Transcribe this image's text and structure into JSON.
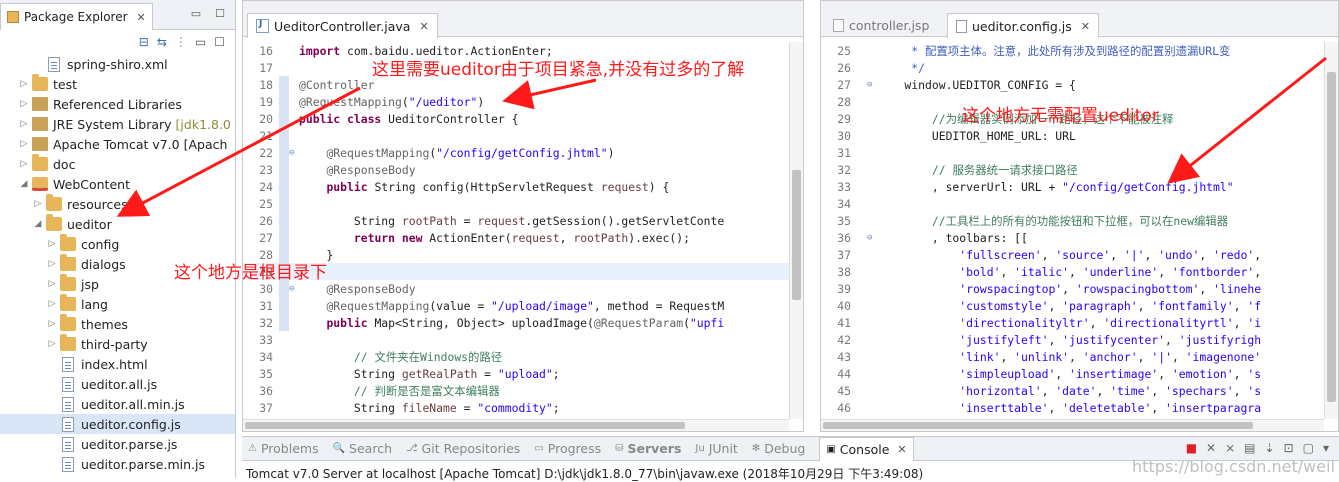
{
  "package_explorer": {
    "title": "Package Explorer",
    "tree": [
      {
        "label": "spring-shiro.xml",
        "indent": 2,
        "icon": "xml-file-icon",
        "twisty": ""
      },
      {
        "label": "test",
        "indent": 1,
        "icon": "folder-icon",
        "twisty": "closed"
      },
      {
        "label": "Referenced Libraries",
        "indent": 1,
        "icon": "library-icon",
        "twisty": "closed"
      },
      {
        "label": "JRE System Library",
        "suffix": "[jdk1.8.0",
        "indent": 1,
        "icon": "library-icon",
        "twisty": "closed"
      },
      {
        "label": "Apache Tomcat v7.0 [Apach",
        "indent": 1,
        "icon": "library-icon",
        "twisty": "closed"
      },
      {
        "label": "doc",
        "indent": 1,
        "icon": "folder-icon",
        "twisty": "closed"
      },
      {
        "label": "WebContent",
        "indent": 1,
        "icon": "webcontent-folder-icon",
        "twisty": "open"
      },
      {
        "label": "resources",
        "indent": 2,
        "icon": "folder-icon",
        "twisty": "closed"
      },
      {
        "label": "ueditor",
        "indent": 2,
        "icon": "folder-icon",
        "twisty": "open"
      },
      {
        "label": "config",
        "indent": 3,
        "icon": "folder-icon",
        "twisty": "closed"
      },
      {
        "label": "dialogs",
        "indent": 3,
        "icon": "folder-icon",
        "twisty": "closed"
      },
      {
        "label": "jsp",
        "indent": 3,
        "icon": "folder-icon",
        "twisty": "closed"
      },
      {
        "label": "lang",
        "indent": 3,
        "icon": "folder-icon",
        "twisty": "closed"
      },
      {
        "label": "themes",
        "indent": 3,
        "icon": "folder-icon",
        "twisty": "closed"
      },
      {
        "label": "third-party",
        "indent": 3,
        "icon": "folder-icon",
        "twisty": "closed"
      },
      {
        "label": "index.html",
        "indent": 3,
        "icon": "file-icon",
        "twisty": ""
      },
      {
        "label": "ueditor.all.js",
        "indent": 3,
        "icon": "file-icon",
        "twisty": ""
      },
      {
        "label": "ueditor.all.min.js",
        "indent": 3,
        "icon": "file-icon",
        "twisty": ""
      },
      {
        "label": "ueditor.config.js",
        "indent": 3,
        "icon": "file-icon",
        "twisty": "",
        "selected": true
      },
      {
        "label": "ueditor.parse.js",
        "indent": 3,
        "icon": "file-icon",
        "twisty": ""
      },
      {
        "label": "ueditor.parse.min.js",
        "indent": 3,
        "icon": "file-icon",
        "twisty": ""
      }
    ]
  },
  "editor_left": {
    "tab": "UeditorController.java",
    "lines": [
      {
        "n": "16",
        "html": "<span class='kw'>import</span> com.baidu.ueditor.ActionEnter;"
      },
      {
        "n": "17",
        "html": ""
      },
      {
        "n": "18",
        "html": "<span class='ann'>@Controller</span>",
        "marker": true
      },
      {
        "n": "19",
        "html": "<span class='ann'>@RequestMapping</span>(<span class='str'>\"/ueditor\"</span>)",
        "marker": true
      },
      {
        "n": "20",
        "html": "<span class='kw'>public class</span> UeditorController {",
        "marker": true
      },
      {
        "n": "21",
        "html": "",
        "marker": true
      },
      {
        "n": "22",
        "html": "    <span class='ann'>@RequestMapping</span>(<span class='str'>\"/config/getConfig.jhtml\"</span>)",
        "marker": true,
        "fold": true
      },
      {
        "n": "23",
        "html": "    <span class='ann'>@ResponseBody</span>",
        "marker": true
      },
      {
        "n": "24",
        "html": "    <span class='kw'>public</span> String config(HttpServletRequest <span style='color:#6a3e3e'>request</span>) {",
        "marker": true
      },
      {
        "n": "25",
        "html": "",
        "marker": true
      },
      {
        "n": "26",
        "html": "        String <span style='color:#6a3e3e'>rootPath</span> = <span style='color:#6a3e3e'>request</span>.getSession().getServletConte",
        "marker": true
      },
      {
        "n": "27",
        "html": "        <span class='kw'>return new</span> ActionEnter(<span style='color:#6a3e3e'>request</span>, <span style='color:#6a3e3e'>rootPath</span>).exec();",
        "marker": true
      },
      {
        "n": "28",
        "html": "    }",
        "marker": true
      },
      {
        "n": "29",
        "html": "",
        "marker": true,
        "hl": true
      },
      {
        "n": "30",
        "html": "    <span class='ann'>@ResponseBody</span>",
        "marker": true,
        "fold": true
      },
      {
        "n": "31",
        "html": "    <span class='ann'>@RequestMapping</span>(value = <span class='str'>\"/upload/image\"</span>, method = RequestM",
        "marker": true
      },
      {
        "n": "32",
        "html": "    <span class='kw'>public</span> Map&lt;String, Object&gt; uploadImage(<span class='ann'>@RequestParam</span>(<span class='str'>\"upfi</span>",
        "marker": true
      },
      {
        "n": "33",
        "html": ""
      },
      {
        "n": "34",
        "html": "        <span class='cmt'>// 文件夹在Windows的路径</span>"
      },
      {
        "n": "35",
        "html": "        String <span style='color:#6a3e3e'>getRealPath</span> = <span class='str'>\"upload\"</span>;"
      },
      {
        "n": "36",
        "html": "        <span class='cmt'>// 判断是否是富文本编辑器</span>"
      },
      {
        "n": "37",
        "html": "        String <span style='color:#6a3e3e'>fileName</span> = <span class='str'>\"commodity\"</span>;"
      }
    ]
  },
  "editor_right": {
    "tabs": [
      "controller.jsp",
      "ueditor.config.js"
    ],
    "lines": [
      {
        "n": "25",
        "html": "     <span class='jscm'>* 配置项主体。注意，此处所有涉及到路径的配置别遗漏URL变</span>"
      },
      {
        "n": "26",
        "html": "     <span class='jscm'>*/</span>"
      },
      {
        "n": "27",
        "html": "    window.UEDITOR_CONFIG = {",
        "fold": true
      },
      {
        "n": "28",
        "html": ""
      },
      {
        "n": "29",
        "html": "        <span class='cmt'>//为编辑器实例添加一个路径，这个不能被注释</span>"
      },
      {
        "n": "30",
        "html": "        UEDITOR_HOME_URL: URL"
      },
      {
        "n": "31",
        "html": ""
      },
      {
        "n": "32",
        "html": "        <span class='cmt'>// 服务器统一请求接口路径</span>"
      },
      {
        "n": "33",
        "html": "        , serverUrl: URL + <span class='str'>\"/config/getConfig.jhtml\"</span>"
      },
      {
        "n": "34",
        "html": ""
      },
      {
        "n": "35",
        "html": "        <span class='cmt'>//工具栏上的所有的功能按钮和下拉框，可以在new编辑器</span>"
      },
      {
        "n": "36",
        "html": "        , toolbars: [[",
        "fold": true
      },
      {
        "n": "37",
        "html": "            <span class='str'>'fullscreen'</span>, <span class='str'>'source'</span>, <span class='str'>'|'</span>, <span class='str'>'undo'</span>, <span class='str'>'redo'</span>,"
      },
      {
        "n": "38",
        "html": "            <span class='str'>'bold'</span>, <span class='str'>'italic'</span>, <span class='str'>'underline'</span>, <span class='str'>'fontborder'</span>,"
      },
      {
        "n": "39",
        "html": "            <span class='str'>'rowspacingtop'</span>, <span class='str'>'rowspacingbottom'</span>, <span class='str'>'linehe</span>"
      },
      {
        "n": "40",
        "html": "            <span class='str'>'customstyle'</span>, <span class='str'>'paragraph'</span>, <span class='str'>'fontfamily'</span>, <span class='str'>'f</span>"
      },
      {
        "n": "41",
        "html": "            <span class='str'>'directionalityltr'</span>, <span class='str'>'directionalityrtl'</span>, <span class='str'>'i</span>"
      },
      {
        "n": "42",
        "html": "            <span class='str'>'justifyleft'</span>, <span class='str'>'justifycenter'</span>, <span class='str'>'justifyrigh</span>"
      },
      {
        "n": "43",
        "html": "            <span class='str'>'link'</span>, <span class='str'>'unlink'</span>, <span class='str'>'anchor'</span>, <span class='str'>'|'</span>, <span class='str'>'imagenone'</span>"
      },
      {
        "n": "44",
        "html": "            <span class='str'>'simpleupload'</span>, <span class='str'>'insertimage'</span>, <span class='str'>'emotion'</span>, <span class='str'>'s</span>"
      },
      {
        "n": "45",
        "html": "            <span class='str'>'horizontal'</span>, <span class='str'>'date'</span>, <span class='str'>'time'</span>, <span class='str'>'spechars'</span>, <span class='str'>'s</span>"
      },
      {
        "n": "46",
        "html": "            <span class='str'>'inserttable'</span>, <span class='str'>'deletetable'</span>, <span class='str'>'insertparagra</span>"
      }
    ]
  },
  "console": {
    "tabs": [
      "Problems",
      "Search",
      "Git Repositories",
      "Progress",
      "Servers",
      "JUnit",
      "Debug",
      "Console"
    ],
    "active_tab": "Console",
    "status_line": "Tomcat v7.0 Server at localhost [Apache Tomcat] D:\\jdk\\jdk1.8.0_77\\bin\\javaw.exe (2018年10月29日 下午3:49:08)"
  },
  "annotations": {
    "note_top": "这里需要ueditor由于项目紧急,并没有过多的了解",
    "note_right": "这个地方无需配置ueditor",
    "note_left": "这个地方是根目录下"
  },
  "watermark": "https://blog.csdn.net/weil",
  "colors": {
    "annotation": "#ff1a1a",
    "keyword": "#7f0055",
    "string": "#2a00ff",
    "comment": "#3f7f5f"
  }
}
